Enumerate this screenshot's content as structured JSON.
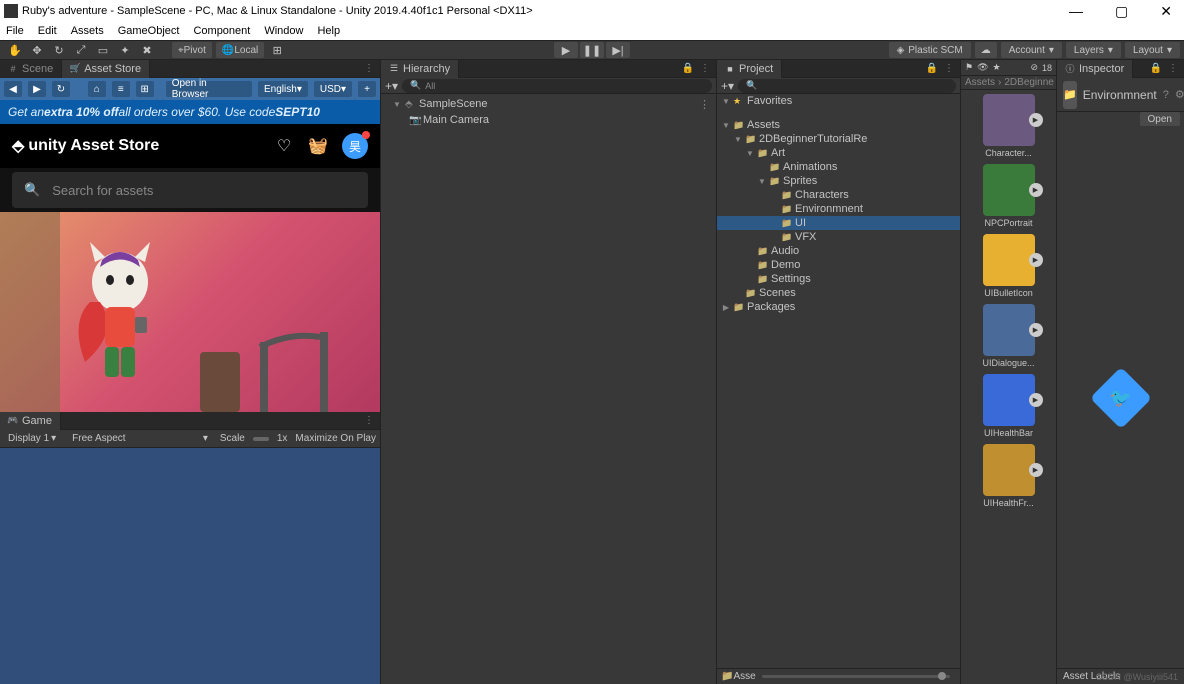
{
  "window": {
    "title": "Ruby's adventure - SampleScene - PC, Mac & Linux Standalone - Unity 2019.4.40f1c1 Personal <DX11>",
    "menus": [
      "File",
      "Edit",
      "Assets",
      "GameObject",
      "Component",
      "Window",
      "Help"
    ]
  },
  "toolbar": {
    "pivot": "Pivot",
    "local": "Local",
    "plastic": "Plastic SCM",
    "account": "Account",
    "layers": "Layers",
    "layout": "Layout"
  },
  "scene_tab": "Scene",
  "asset_store_tab": "Asset Store",
  "asset_store": {
    "open_in_browser": "Open in Browser",
    "language": "English",
    "currency": "USD",
    "promo_prefix": "Get an ",
    "promo_bold": "extra 10% off",
    "promo_mid": " all orders over $60. Use code ",
    "promo_code": "SEPT10",
    "logo": "unity Asset Store",
    "search_placeholder": "Search for assets",
    "avatar_char": "昊"
  },
  "game": {
    "tab": "Game",
    "display": "Display 1",
    "aspect": "Free Aspect",
    "scale_label": "Scale",
    "scale_val": "1x",
    "maximize": "Maximize On Play"
  },
  "hierarchy": {
    "tab": "Hierarchy",
    "search_hint": "All",
    "scene": "SampleScene",
    "items": [
      "Main Camera"
    ]
  },
  "project": {
    "tab": "Project",
    "favorites": "Favorites",
    "root": "Assets",
    "tree": {
      "tutorial": "2DBeginnerTutorialRe",
      "art": "Art",
      "animations": "Animations",
      "sprites": "Sprites",
      "characters": "Characters",
      "environment": "Environmnent",
      "ui": "UI",
      "vfx": "VFX",
      "audio": "Audio",
      "demo": "Demo",
      "settings": "Settings",
      "scenes": "Scenes",
      "packages": "Packages"
    },
    "footer": "Asse"
  },
  "thumbs": {
    "count": "18",
    "breadcrumb1": "Assets",
    "breadcrumb2": "2DBeginne",
    "items": [
      {
        "label": "Character...",
        "bg": "#6b5980"
      },
      {
        "label": "NPCPortrait",
        "bg": "#3a7a3a"
      },
      {
        "label": "UIBulletIcon",
        "bg": "#e8b030"
      },
      {
        "label": "UIDialogue...",
        "bg": "#4a6a9a"
      },
      {
        "label": "UIHealthBar",
        "bg": "#3a6ad8"
      },
      {
        "label": "UIHealthFr...",
        "bg": "#c09030"
      }
    ]
  },
  "inspector": {
    "tab": "Inspector",
    "name": "Environmnent",
    "open": "Open",
    "asset_labels": "Asset Labels"
  },
  "watermark": "CSDN @Wusiyiii541"
}
